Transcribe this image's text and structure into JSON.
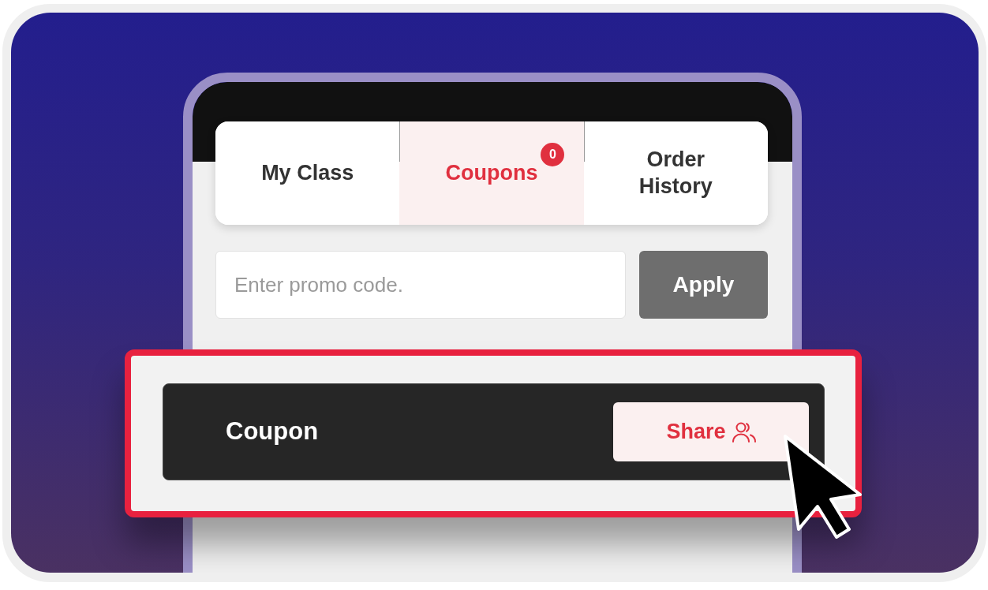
{
  "tabs": [
    {
      "label": "My Class",
      "selected": false
    },
    {
      "label": "Coupons",
      "selected": true,
      "badge": "0"
    },
    {
      "label": "Order History",
      "selected": false
    }
  ],
  "promo": {
    "placeholder": "Enter promo code.",
    "button": "Apply"
  },
  "coupon": {
    "title": "Coupon",
    "share_button": "Share"
  }
}
